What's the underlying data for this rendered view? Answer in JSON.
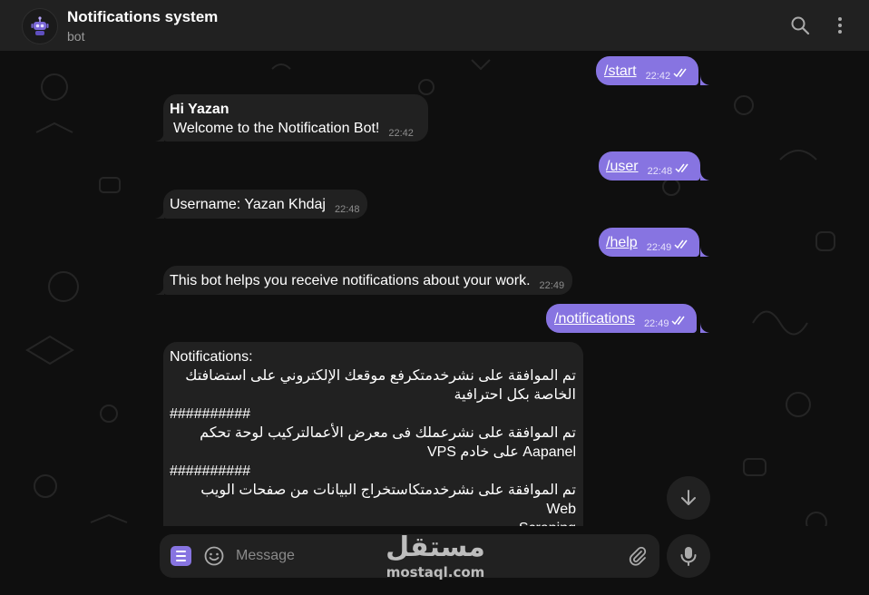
{
  "header": {
    "title": "Notifications system",
    "subtitle": "bot",
    "search_icon": "search-icon",
    "menu_icon": "more-vertical-icon"
  },
  "messages": [
    {
      "dir": "out",
      "text": "/start",
      "time": "22:42"
    },
    {
      "dir": "in",
      "title": "Hi Yazan",
      "text": "Welcome to the Notification Bot!",
      "time": "22:42"
    },
    {
      "dir": "out",
      "text": "/user",
      "time": "22:48"
    },
    {
      "dir": "in",
      "text": "Username: Yazan Khdaj",
      "time": "22:48"
    },
    {
      "dir": "out",
      "text": "/help",
      "time": "22:49"
    },
    {
      "dir": "in",
      "text": "This bot helps you receive notifications about your work.",
      "time": "22:49"
    },
    {
      "dir": "out",
      "text": "/notifications",
      "time": "22:49"
    },
    {
      "dir": "in",
      "title": "Notifications:",
      "lines": [
        "تم الموافقة على نشرخدمتكرفع موقعك الإلكتروني على استضافتك",
        "الخاصة بكل احترافية",
        "##########",
        "تم الموافقة على نشرعملك فى معرض الأعمالتركيب لوحة تحكم",
        "Aapanel على خادم VPS",
        "##########",
        "تم الموافقة على نشرخدمتكاستخراج البيانات من صفحات الويب Web",
        "Scraping",
        "##########"
      ]
    }
  ],
  "composer": {
    "placeholder": "Message"
  },
  "watermark": {
    "arabic": "مستقل",
    "latin": "mostaql.com"
  },
  "colors": {
    "outgoing": "#8774e1",
    "incoming": "#212121",
    "header": "#212121"
  }
}
